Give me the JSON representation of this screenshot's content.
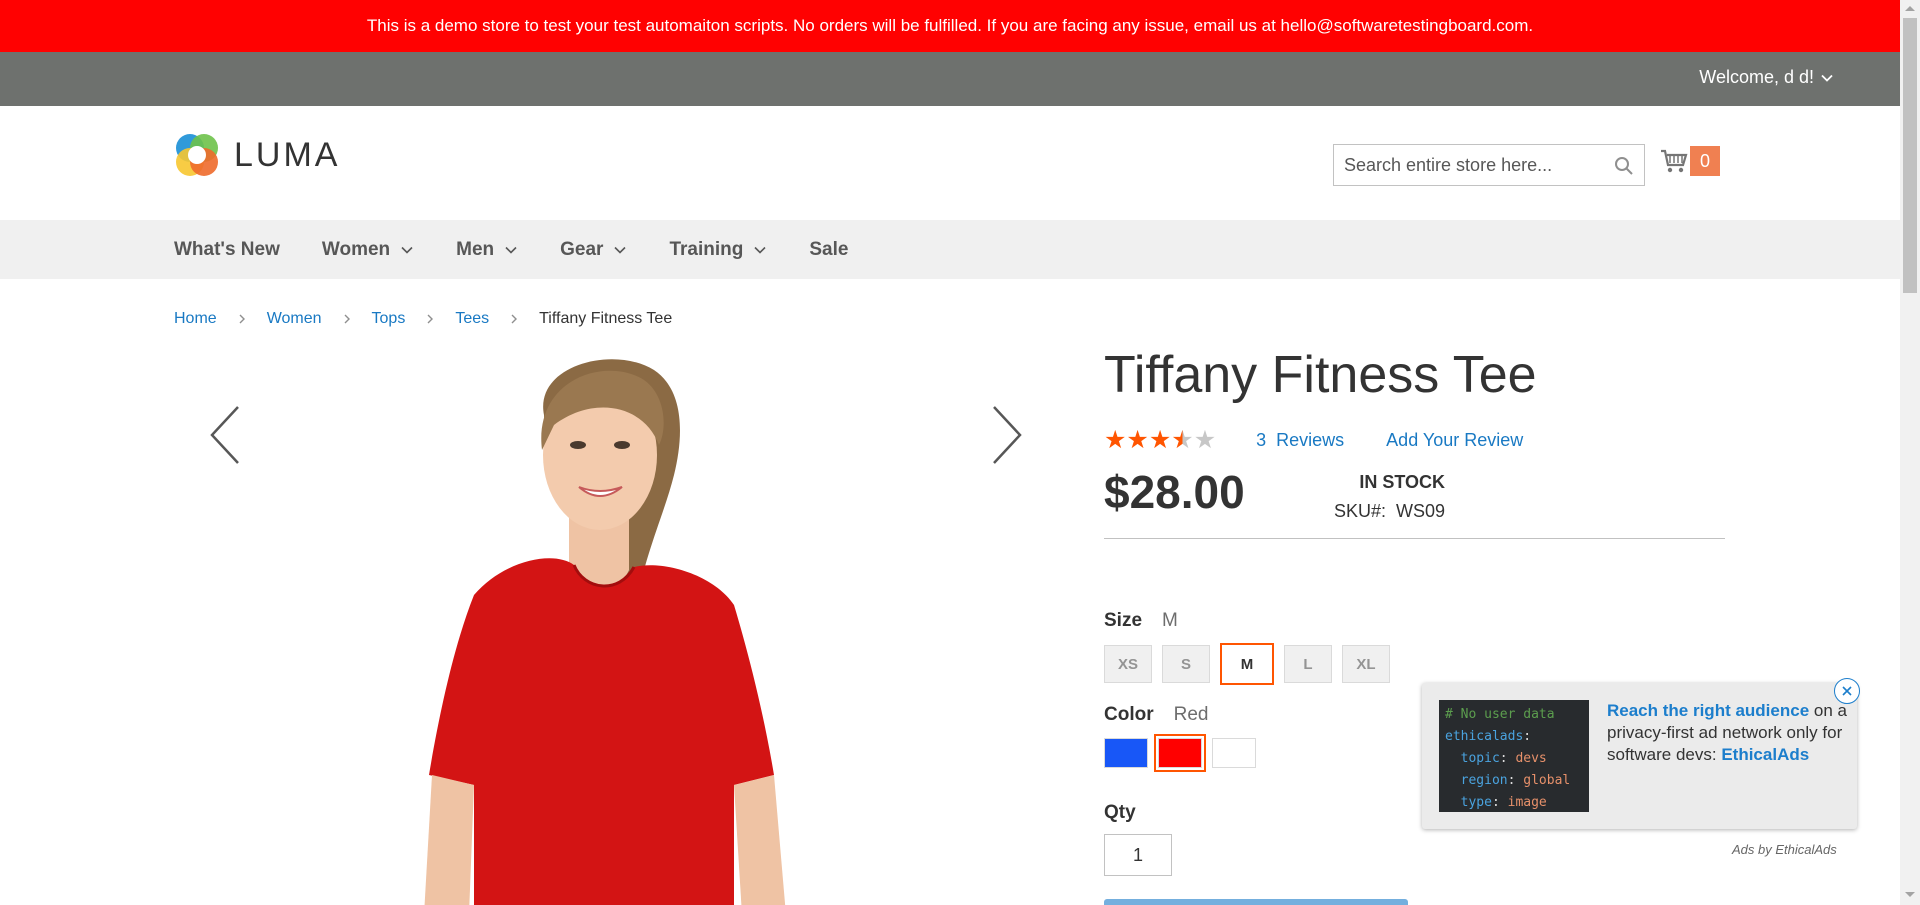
{
  "banner": {
    "text": "This is a demo store to test your test automaiton scripts. No orders will be fulfilled. If you are facing any issue, email us at hello@softwaretestingboard.com."
  },
  "top_bar": {
    "welcome": "Welcome, d d!",
    "welcome_icon": "chevron-down-icon"
  },
  "header": {
    "logo_text": "LUMA",
    "search_placeholder": "Search entire store here...",
    "cart_count": "0"
  },
  "nav": {
    "items": [
      {
        "label": "What's New",
        "dropdown": false
      },
      {
        "label": "Women",
        "dropdown": true
      },
      {
        "label": "Men",
        "dropdown": true
      },
      {
        "label": "Gear",
        "dropdown": true
      },
      {
        "label": "Training",
        "dropdown": true
      },
      {
        "label": "Sale",
        "dropdown": false
      }
    ]
  },
  "breadcrumb": {
    "items": [
      "Home",
      "Women",
      "Tops",
      "Tees"
    ],
    "current": "Tiffany Fitness Tee"
  },
  "product": {
    "title": "Tiffany Fitness Tee",
    "rating": 3.5,
    "rating_max": 5,
    "reviews_count": "3",
    "reviews_label": "Reviews",
    "add_review": "Add Your Review",
    "price": "$28.00",
    "stock": "In stock",
    "sku_label": "SKU#:",
    "sku_value": "WS09",
    "size_label": "Size",
    "size_selected": "M",
    "sizes": [
      "XS",
      "S",
      "M",
      "L",
      "XL"
    ],
    "color_label": "Color",
    "color_selected": "Red",
    "colors": [
      {
        "name": "Blue",
        "hex": "#1857f7"
      },
      {
        "name": "Red",
        "hex": "#ff0000"
      },
      {
        "name": "White",
        "hex": "#ffffff"
      }
    ],
    "qty_label": "Qty",
    "qty_value": "1"
  },
  "ad": {
    "code_lines": [
      {
        "text": "# No user data",
        "color": "#5c9e4e"
      },
      {
        "key": "ethicalads",
        "value": "",
        "colon": true
      },
      {
        "key": "  topic",
        "value": " devs"
      },
      {
        "key": "  region",
        "value": " global"
      },
      {
        "key": "  type",
        "value": " image"
      }
    ],
    "headline": "Reach the right audience",
    "body_1": " on a privacy-first ad network only for software devs: ",
    "brand": "EthicalAds",
    "by": "Ads by EthicalAds"
  },
  "colors": {
    "banner": "#ff0101",
    "top_bar": "#6e716e",
    "accent": "#ff5501",
    "link": "#1979c3",
    "star": "#ff5501",
    "star_empty": "#c7c7c7"
  }
}
